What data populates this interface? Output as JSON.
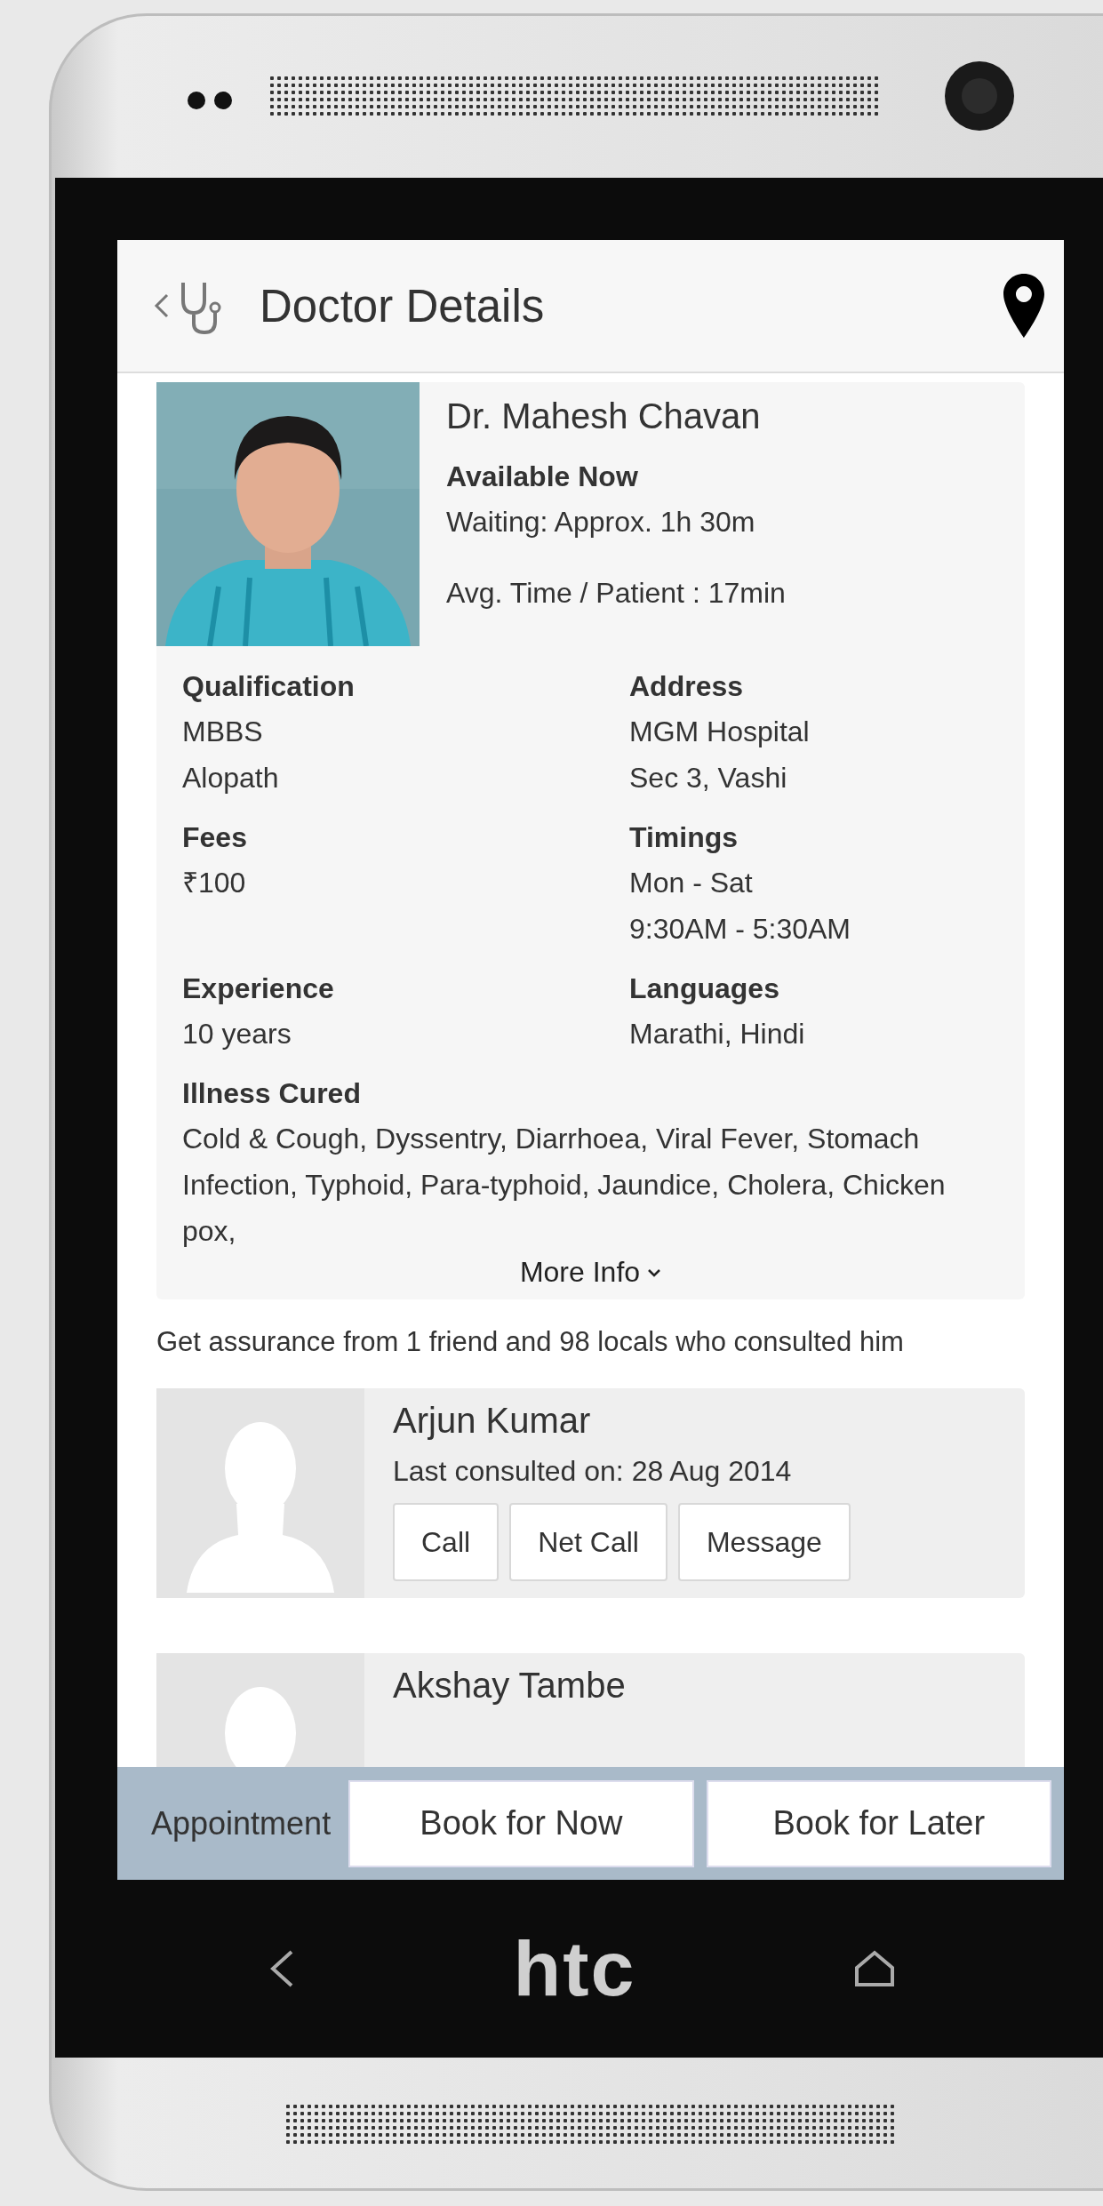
{
  "header": {
    "title": "Doctor Details"
  },
  "doctor": {
    "name": "Dr. Mahesh Chavan",
    "availability": "Available Now",
    "waiting": "Waiting: Approx. 1h 30m",
    "avg_time": "Avg. Time / Patient : 17min",
    "details": [
      {
        "label": "Qualification",
        "lines": [
          "MBBS",
          "Alopath"
        ]
      },
      {
        "label": "Address",
        "lines": [
          "MGM Hospital",
          "Sec 3, Vashi"
        ]
      },
      {
        "label": "Fees",
        "lines": [
          "₹100"
        ]
      },
      {
        "label": "Timings",
        "lines": [
          "Mon - Sat",
          "9:30AM - 5:30AM"
        ]
      },
      {
        "label": "Experience",
        "lines": [
          "10 years"
        ]
      },
      {
        "label": "Languages",
        "lines": [
          "Marathi, Hindi"
        ]
      }
    ],
    "illness": {
      "label": "Illness Cured",
      "text": "Cold & Cough, Dyssentry, Diarrhoea, Viral Fever, Stomach Infection, Typhoid, Para-typhoid, Jaundice, Cholera, Chicken pox,"
    },
    "more_info": "More Info"
  },
  "assurance": "Get assurance from 1 friend and 98 locals who consulted him",
  "consultants": [
    {
      "name": "Arjun Kumar",
      "last_consulted": "Last consulted on: 28 Aug 2014",
      "actions": [
        "Call",
        "Net Call",
        "Message"
      ]
    },
    {
      "name": "Akshay Tambe"
    }
  ],
  "bottom_bar": {
    "label": "Appointment",
    "buttons": [
      "Book for Now",
      "Book for Later"
    ]
  },
  "device": {
    "brand": "htc"
  }
}
